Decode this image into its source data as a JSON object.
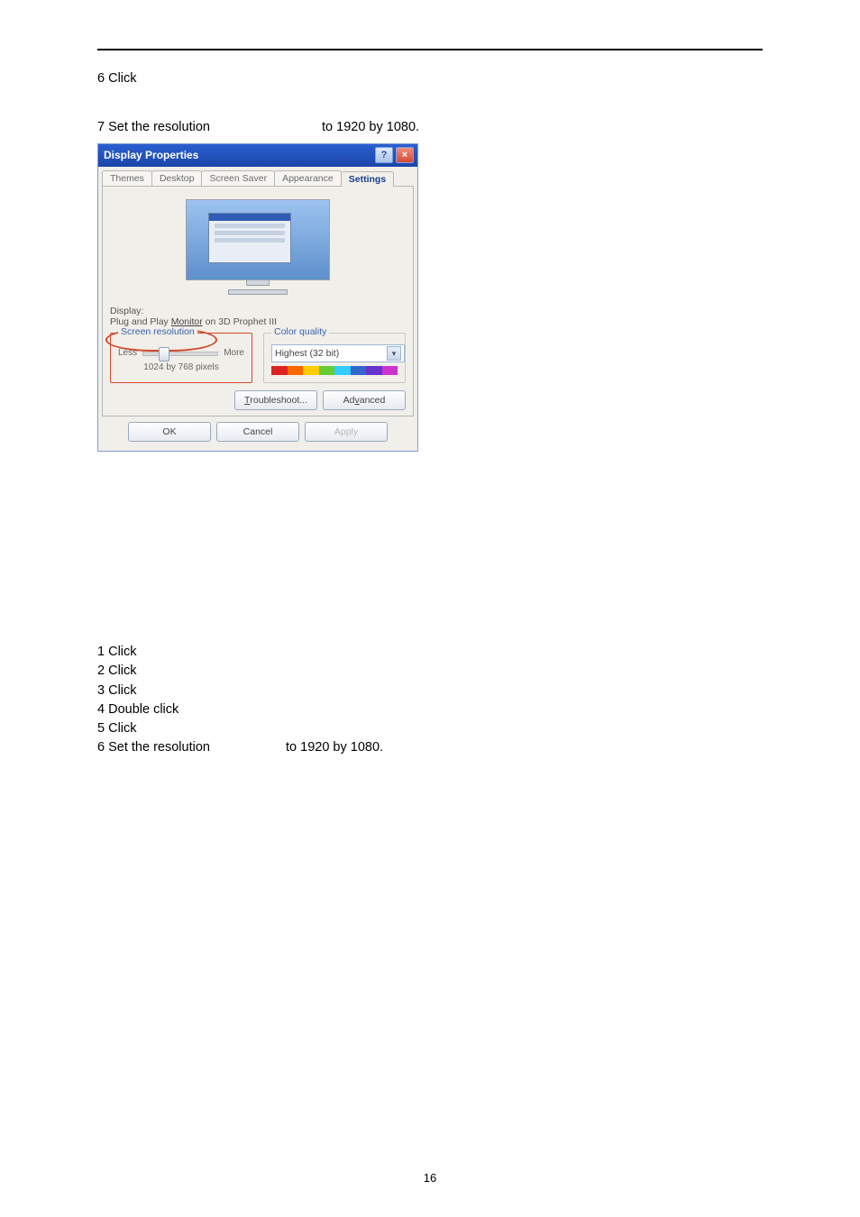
{
  "top": {
    "step6": "6 Click",
    "step7a": "7 Set the resolution",
    "step7b": "to 1920 by 1080."
  },
  "dialog": {
    "title": "Display Properties",
    "help": "?",
    "close": "×",
    "tabs": {
      "themes": "Themes",
      "desktop": "Desktop",
      "saver": "Screen Saver",
      "appearance": "Appearance",
      "settings": "Settings"
    },
    "display_label": "Display:",
    "display_value_pre": "Plug and Play ",
    "display_value_link": "Monitor",
    "display_value_post": " on 3D Prophet III",
    "res_legend": "Screen resolution",
    "less": "Less",
    "more": "More",
    "res_value": "1024 by 768 pixels",
    "cq_legend": "Color quality",
    "cq_value": "Highest (32 bit)",
    "troubleshoot": "Troubleshoot...",
    "advanced": "Advanced",
    "ok": "OK",
    "cancel": "Cancel",
    "apply": "Apply"
  },
  "list": {
    "s1": "1 Click",
    "s2": "2 Click",
    "s3": "3 Click",
    "s4": "4 Double click",
    "s5": "5 Click",
    "s6a": "6 Set the resolution",
    "s6b": "to 1920 by 1080."
  },
  "page_number": "16",
  "colorbar": [
    "#d22",
    "#f60",
    "#fc0",
    "#6c3",
    "#3cf",
    "#36c",
    "#63c",
    "#c3c"
  ]
}
